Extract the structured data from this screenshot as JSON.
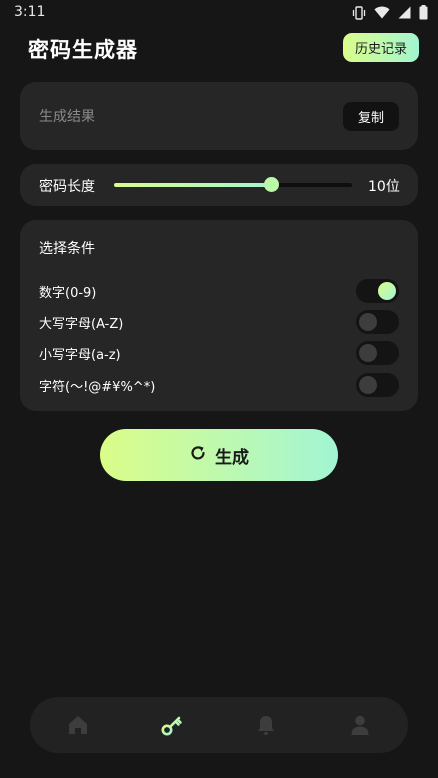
{
  "status_bar": {
    "time": "3:11",
    "icons": [
      "vibrate-icon",
      "wifi-icon",
      "signal-icon",
      "battery-icon"
    ]
  },
  "header": {
    "title": "密码生成器",
    "history_label": "历史记录"
  },
  "result": {
    "label": "生成结果",
    "copy_label": "复制"
  },
  "length": {
    "label": "密码长度",
    "value_text": "10位",
    "slider_fraction": 0.66
  },
  "conditions": {
    "title": "选择条件",
    "items": [
      {
        "label": "数字(0-9)",
        "enabled": true
      },
      {
        "label": "大写字母(A-Z)",
        "enabled": false
      },
      {
        "label": "小写字母(a-z)",
        "enabled": false
      },
      {
        "label": "字符(～!@#¥%^*)",
        "enabled": false
      }
    ]
  },
  "generate": {
    "label": "生成",
    "icon": "refresh-icon"
  },
  "bottom_nav": {
    "items": [
      "home-icon",
      "key-icon",
      "bell-icon",
      "user-icon"
    ],
    "active": "key-icon"
  },
  "colors": {
    "background": "#161616",
    "card": "#262626",
    "accent_start": "#dafd8a",
    "accent_end": "#a2f5d1"
  }
}
